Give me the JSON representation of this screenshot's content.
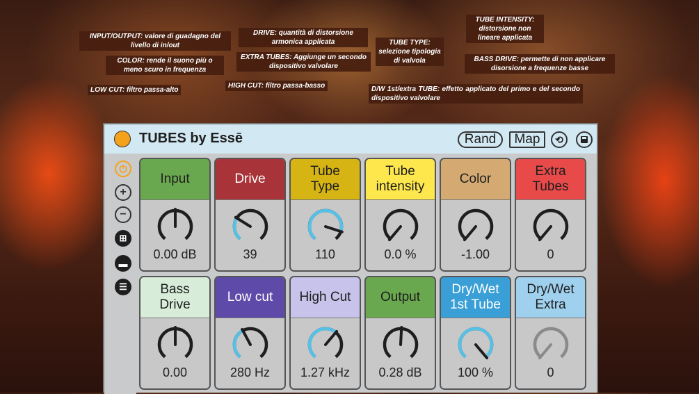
{
  "annotations": {
    "input_output": "INPUT/OUTPUT: valore di guadagno del livello di in/out",
    "color": "COLOR: rende il suono più o meno scuro in frequenza",
    "low_cut": "LOW CUT: filtro passa-alto",
    "drive": "DRIVE: quantità di distorsione armonica applicata",
    "extra_tubes": "EXTRA TUBES: Aggiunge un secondo dispositivo valvolare",
    "high_cut": "HIGH CUT: filtro passa-basso",
    "tube_type": "TUBE TYPE: selezione tipologia di valvola",
    "dry_wet": "D/W 1st/extra TUBE: effetto applicato del primo e del secondo dispositivo valvolare",
    "tube_intensity": "TUBE INTENSITY: distorsione non lineare applicata",
    "bass_drive": "BASS DRIVE: permette di non applicare disorsione a frequenze basse"
  },
  "device": {
    "title": "TUBES by Essē",
    "rand_label": "Rand",
    "map_label": "Map",
    "accent": "#f4a21c",
    "title_bg": "#d2e8f2"
  },
  "params": [
    {
      "name": "Input",
      "value": "0.00 dB",
      "color": "#6aa84f",
      "text_color": "#1e1e1e",
      "angle": 0,
      "level": 0.5,
      "dim": false
    },
    {
      "name": "Drive",
      "value": "39",
      "color": "#a8343a",
      "text_color": "#ffffff",
      "angle": -58,
      "level": 0.3,
      "dim": false
    },
    {
      "name": "Tube\nType",
      "value": "110",
      "color": "#d6b414",
      "text_color": "#1e1e1e",
      "angle": 108,
      "level": 0.85,
      "dim": false
    },
    {
      "name": "Tube\nintensity",
      "value": "0.0 %",
      "color": "#fde74c",
      "text_color": "#1e1e1e",
      "angle": -140,
      "level": 0,
      "dim": false
    },
    {
      "name": "Color",
      "value": "-1.00",
      "color": "#d4aa72",
      "text_color": "#1e1e1e",
      "angle": -140,
      "level": 0,
      "dim": false
    },
    {
      "name": "Extra\nTubes",
      "value": "0",
      "color": "#e84a4a",
      "text_color": "#1e1e1e",
      "angle": -140,
      "level": 0,
      "dim": false
    },
    {
      "name": "Bass\nDrive",
      "value": "0.00",
      "color": "#d7ecd9",
      "text_color": "#1e1e1e",
      "angle": 0,
      "level": 0.5,
      "dim": false
    },
    {
      "name": "Low cut",
      "value": "280 Hz",
      "color": "#5e4aa8",
      "text_color": "#ffffff",
      "angle": -28,
      "level": 0.4,
      "dim": false
    },
    {
      "name": "High Cut",
      "value": "1.27 kHz",
      "color": "#c7c3ea",
      "text_color": "#1e1e1e",
      "angle": 40,
      "level": 0.65,
      "dim": false
    },
    {
      "name": "Output",
      "value": "0.28 dB",
      "color": "#6aa84f",
      "text_color": "#1e1e1e",
      "angle": 3,
      "level": 0.51,
      "dim": false
    },
    {
      "name": "Dry/Wet\n1st Tube",
      "value": "100 %",
      "color": "#3a9fd6",
      "text_color": "#ffffff",
      "angle": 140,
      "level": 1,
      "dim": false
    },
    {
      "name": "Dry/Wet\nExtra",
      "value": "0",
      "color": "#9fd0ee",
      "text_color": "#1e1e1e",
      "angle": -140,
      "level": 0,
      "dim": true
    }
  ],
  "sidebar_icons": [
    "power-preset-icon",
    "zoom-in-icon",
    "zoom-out-icon",
    "add-device-icon",
    "collapse-icon",
    "list-icon"
  ],
  "knob_colors": {
    "track": "#1e1e1e",
    "active": "#56c1e6",
    "dim": "#8a8a8a"
  }
}
